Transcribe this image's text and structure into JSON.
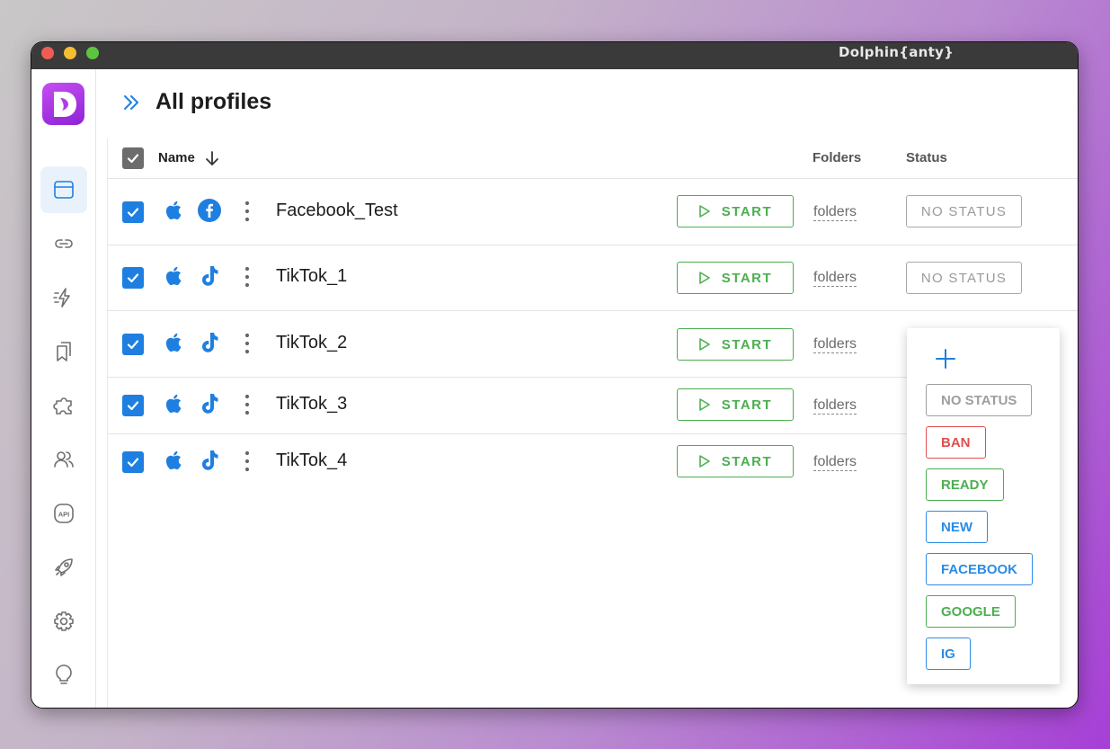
{
  "window": {
    "title": "Dolphin{anty}"
  },
  "sidebar": {
    "items": [
      {
        "icon": "browser-window-icon",
        "active": true
      },
      {
        "icon": "link-icon"
      },
      {
        "icon": "lightning-icon"
      },
      {
        "icon": "bookmarks-icon"
      },
      {
        "icon": "puzzle-icon"
      },
      {
        "icon": "users-icon"
      },
      {
        "icon": "api-icon",
        "text": "API"
      },
      {
        "icon": "rocket-icon"
      },
      {
        "icon": "gear-icon"
      },
      {
        "icon": "lightbulb-icon"
      }
    ]
  },
  "header": {
    "title": "All profiles"
  },
  "table": {
    "columns": {
      "name": "Name",
      "folders": "Folders",
      "status": "Status"
    },
    "rows": [
      {
        "name": "Facebook_Test",
        "platform": "apple-icon",
        "social": "facebook-icon",
        "start_label": "START",
        "folders": "folders",
        "status": "NO STATUS"
      },
      {
        "name": "TikTok_1",
        "platform": "apple-icon",
        "social": "tiktok-icon",
        "start_label": "START",
        "folders": "folders",
        "status": "NO STATUS"
      },
      {
        "name": "TikTok_2",
        "platform": "apple-icon",
        "social": "tiktok-icon",
        "start_label": "START",
        "folders": "folders",
        "status": ""
      },
      {
        "name": "TikTok_3",
        "platform": "apple-icon",
        "social": "tiktok-icon",
        "start_label": "START",
        "folders": "folders",
        "status": ""
      },
      {
        "name": "TikTok_4",
        "platform": "apple-icon",
        "social": "tiktok-icon",
        "start_label": "START",
        "folders": "folders",
        "status": ""
      }
    ]
  },
  "status_dropdown": {
    "options": [
      {
        "label": "NO STATUS",
        "color": "#9e9e9e"
      },
      {
        "label": "BAN",
        "color": "#e04e4e"
      },
      {
        "label": "READY",
        "color": "#4caf50"
      },
      {
        "label": "NEW",
        "color": "#2b8ce6"
      },
      {
        "label": "FACEBOOK",
        "color": "#2b8ce6"
      },
      {
        "label": "GOOGLE",
        "color": "#4caf50"
      },
      {
        "label": "IG",
        "color": "#2b8ce6"
      }
    ]
  },
  "colors": {
    "accent": "#1e7fe0",
    "start_green": "#4caf50",
    "logo_purple": "#a83be3"
  }
}
